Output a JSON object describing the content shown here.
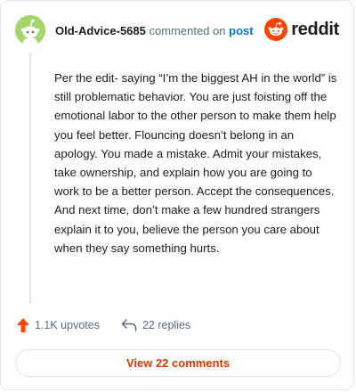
{
  "header": {
    "username": "Old-Advice-5685",
    "action": "commented on",
    "post_link": "post",
    "brand": "reddit"
  },
  "comment": {
    "body": "Per the edit- saying “I’m the biggest AH in the world” is still problematic behavior. You are just foisting off the emotional labor to the other person to make them help you feel better. Flouncing doesn’t belong in an apology. You made a mistake. Admit your mistakes, take ownership, and explain how you are going to work to be a better person. Accept the consequences. And next time, don’t make a few hundred strangers explain it to you, believe the person you care about when they say something hurts."
  },
  "actions": {
    "upvotes": "1.1K upvotes",
    "replies": "22 replies"
  },
  "view_button": "View 22 comments",
  "colors": {
    "brand_orange": "#ff4500",
    "upvote_orange": "#ff4500",
    "link_blue": "#0079d3",
    "avatar_green": "#a4d46c"
  },
  "icons": {
    "avatar": "snoo-avatar-icon",
    "logo": "reddit-logo-icon",
    "upvote": "upvote-arrow-icon",
    "reply": "reply-arrow-icon"
  }
}
